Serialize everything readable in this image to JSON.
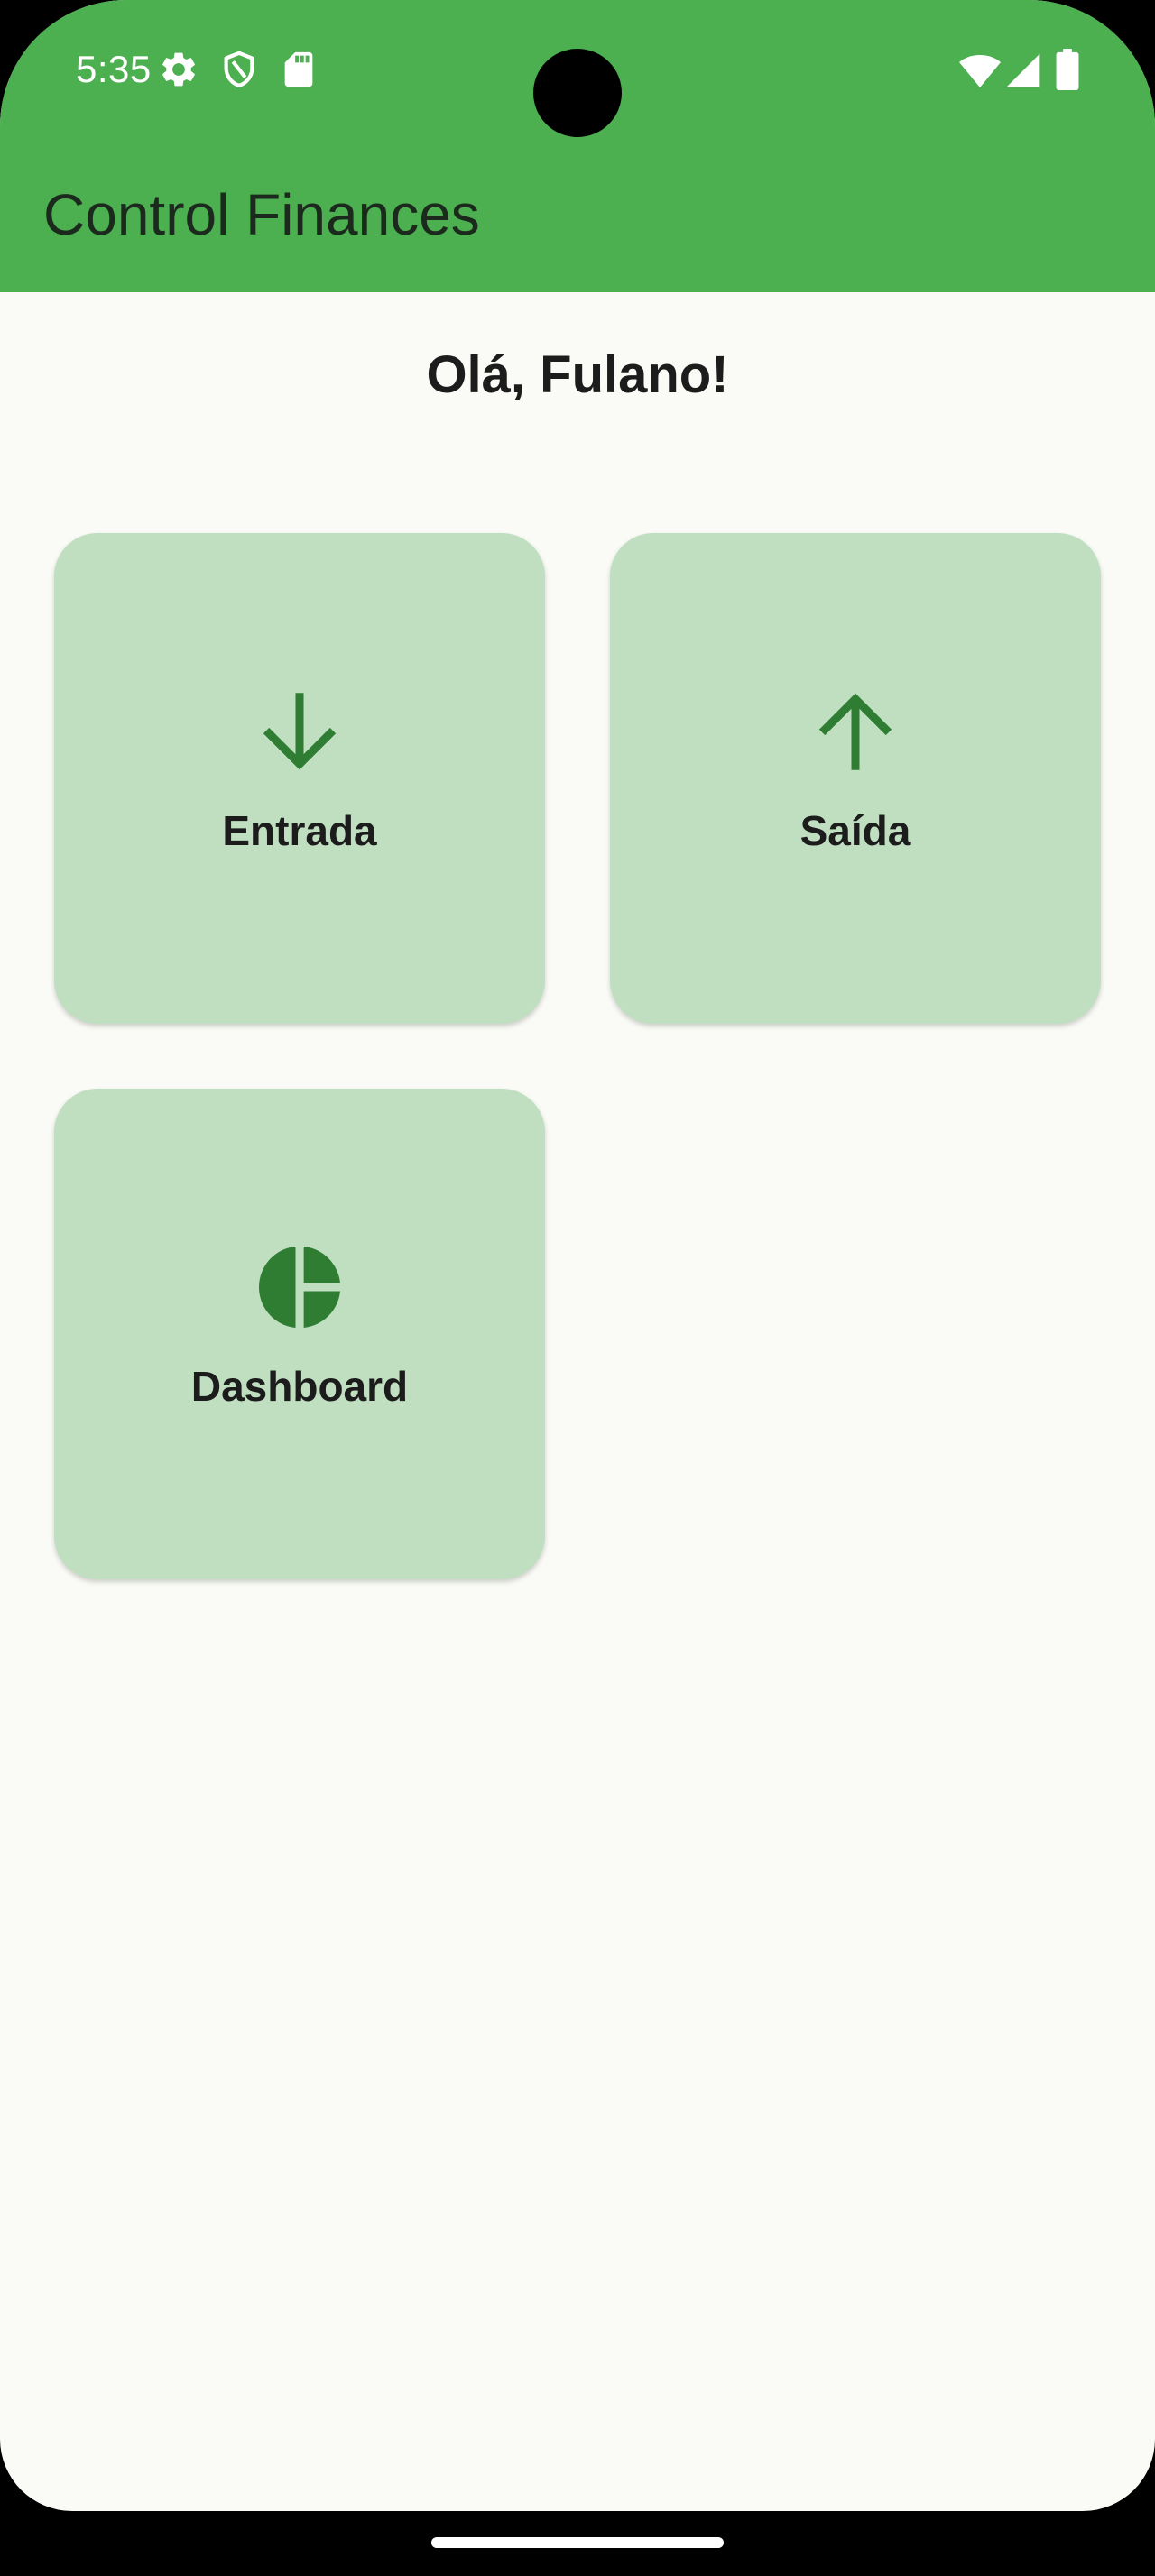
{
  "status_bar": {
    "time": "5:35",
    "icons_left": [
      "gear-icon",
      "shield-icon",
      "sd-card-icon"
    ],
    "icons_right": [
      "wifi-icon",
      "signal-icon",
      "battery-icon"
    ]
  },
  "app_bar": {
    "title": "Control Finances",
    "color": "#4caf50"
  },
  "greeting": "Olá, Fulano!",
  "cards": [
    {
      "label": "Entrada",
      "icon": "arrow-down-icon"
    },
    {
      "label": "Saída",
      "icon": "arrow-up-icon"
    },
    {
      "label": "Dashboard",
      "icon": "pie-chart-icon"
    }
  ],
  "colors": {
    "card_background": "#bfdfc0",
    "icon_color": "#2e7d32",
    "page_background": "#fafbf6"
  }
}
